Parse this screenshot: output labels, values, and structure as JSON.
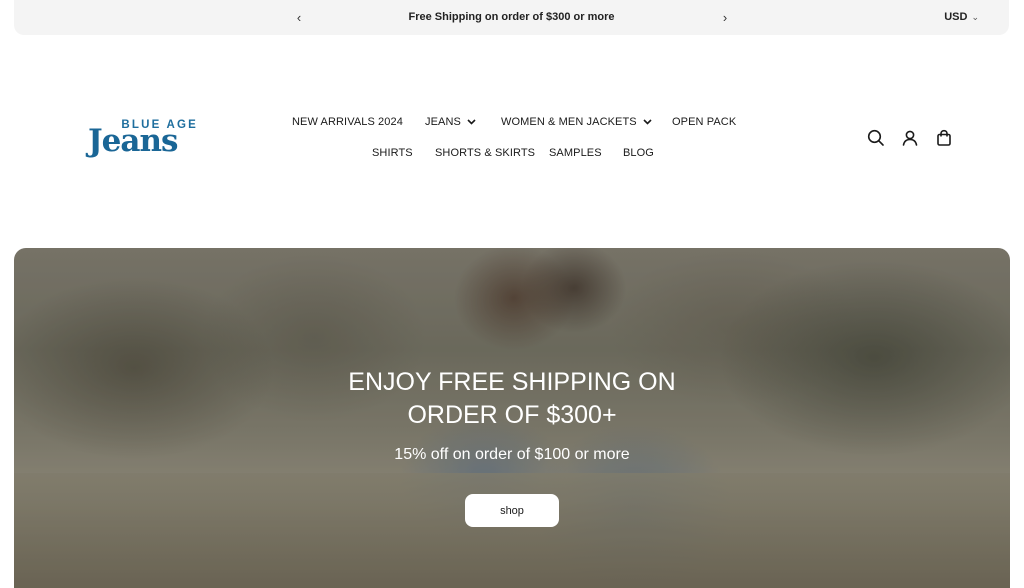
{
  "announcement": {
    "message": "Free Shipping on order of $300 or more",
    "prev_icon": "chevron-left",
    "next_icon": "chevron-right"
  },
  "currency": {
    "selected": "USD"
  },
  "logo": {
    "top_text": "BLUE AGE",
    "main_text": "Jeans",
    "color": "#1a6696"
  },
  "nav": {
    "row1": [
      {
        "label": "NEW ARRIVALS 2024",
        "has_dropdown": false
      },
      {
        "label": "JEANS",
        "has_dropdown": true
      },
      {
        "label": "WOMEN & MEN JACKETS",
        "has_dropdown": true
      },
      {
        "label": "OPEN PACK",
        "has_dropdown": false
      }
    ],
    "row2": [
      {
        "label": "SHIRTS"
      },
      {
        "label": "SHORTS & SKIRTS"
      },
      {
        "label": "SAMPLES"
      },
      {
        "label": "BLOG"
      }
    ]
  },
  "header_icons": [
    "search-icon",
    "account-icon",
    "cart-icon"
  ],
  "hero": {
    "headline_line1": "ENJOY FREE SHIPPING ON",
    "headline_line2": "ORDER OF $300+",
    "subtext": "15% off on order of $100 or more",
    "button_label": "shop"
  }
}
